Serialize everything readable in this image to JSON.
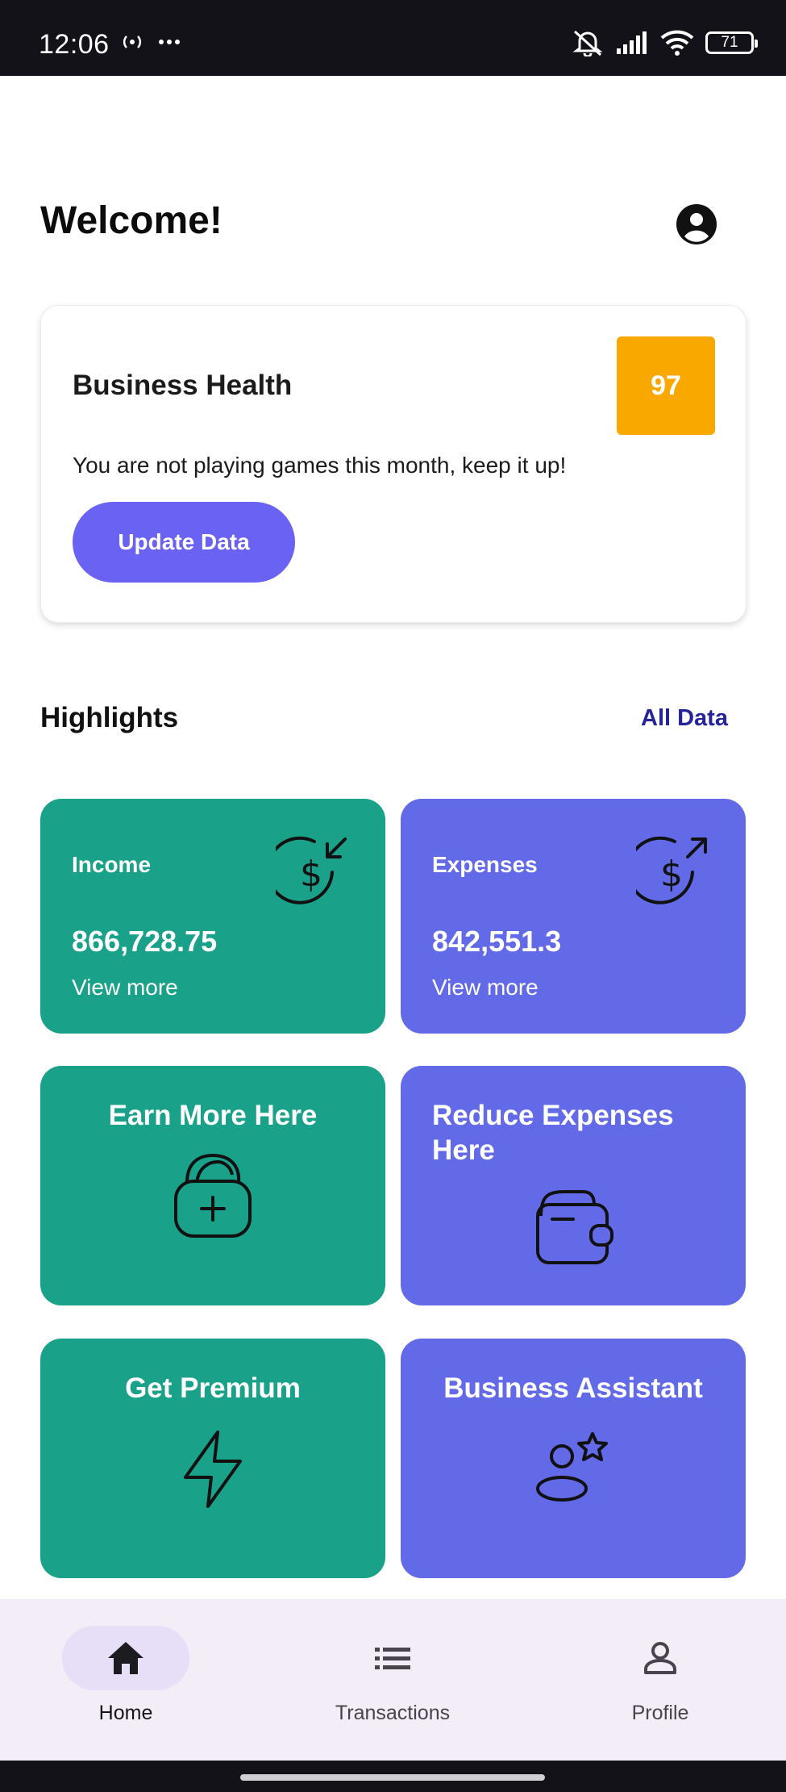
{
  "status_bar": {
    "time": "12:06",
    "battery": "71"
  },
  "header": {
    "title": "Welcome!"
  },
  "business_health": {
    "title": "Business Health",
    "score": "97",
    "message": "You are not playing games this month, keep it up!",
    "update_label": "Update Data"
  },
  "highlights": {
    "title": "Highlights",
    "all_data_label": "All Data"
  },
  "tiles": {
    "income": {
      "label": "Income",
      "value": "866,728.75",
      "more": "View more",
      "icon": "dollar-in-icon"
    },
    "expenses": {
      "label": "Expenses",
      "value": "842,551.3",
      "more": "View more",
      "icon": "dollar-out-icon"
    },
    "earn_more": {
      "label": "Earn More Here",
      "icon": "bag-add-icon"
    },
    "reduce_expenses": {
      "label_line1": "Reduce Expenses",
      "label_line2": "Here",
      "icon": "wallet-icon"
    },
    "premium": {
      "label": "Get Premium",
      "icon": "lightning-icon"
    },
    "assistant": {
      "label": "Business Assistant",
      "icon": "person-star-icon"
    }
  },
  "nav": {
    "items": [
      {
        "label": "Home",
        "icon": "home-icon",
        "active": true
      },
      {
        "label": "Transactions",
        "icon": "list-icon",
        "active": false
      },
      {
        "label": "Profile",
        "icon": "person-icon",
        "active": false
      }
    ]
  },
  "colors": {
    "green_tile": "#1aa189",
    "purple_tile": "#636ae8",
    "score_badge": "#f9a800",
    "primary_button": "#6a62f2",
    "link": "#25239b",
    "nav_background": "#f2edf7",
    "nav_active_pill": "#e7def7"
  }
}
